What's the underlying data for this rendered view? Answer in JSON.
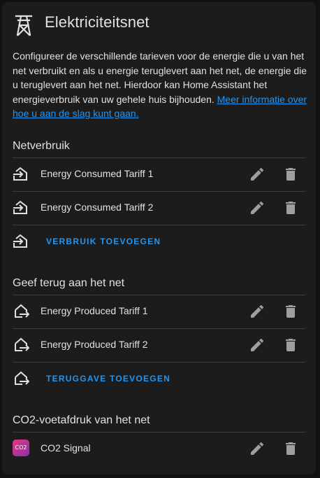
{
  "header": {
    "title": "Elektriciteitsnet",
    "icon": "transmission-tower-icon"
  },
  "description": {
    "text": "Configureer de verschillende tarieven voor de energie die u van het net verbruikt en als u energie teruglevert aan het net, de energie die u teruglevert aan het net. Hierdoor kan Home Assistant het energieverbruik van uw gehele huis bijhouden. ",
    "link": "Meer informatie over hoe u aan de slag kunt gaan."
  },
  "consumption": {
    "title": "Netverbruik",
    "items": [
      {
        "label": "Energy Consumed Tariff 1",
        "icon": "transmission-tower-import-icon"
      },
      {
        "label": "Energy Consumed Tariff 2",
        "icon": "transmission-tower-import-icon"
      }
    ],
    "add_label": "VERBRUIK TOEVOEGEN"
  },
  "return": {
    "title": "Geef terug aan het net",
    "items": [
      {
        "label": "Energy Produced Tariff 1",
        "icon": "transmission-tower-export-icon"
      },
      {
        "label": "Energy Produced Tariff 2",
        "icon": "transmission-tower-export-icon"
      }
    ],
    "add_label": "TERUGGAVE TOEVOEGEN"
  },
  "co2": {
    "title": "CO2-voetafdruk van het net",
    "items": [
      {
        "label": "CO2 Signal",
        "icon": "co2-signal-logo",
        "badge_text": "CO2"
      }
    ]
  },
  "colors": {
    "background": "#111111",
    "card": "#1c1c1c",
    "accent": "#2196f3",
    "text": "#e1e1e1",
    "icon_muted": "#9e9e9e"
  }
}
